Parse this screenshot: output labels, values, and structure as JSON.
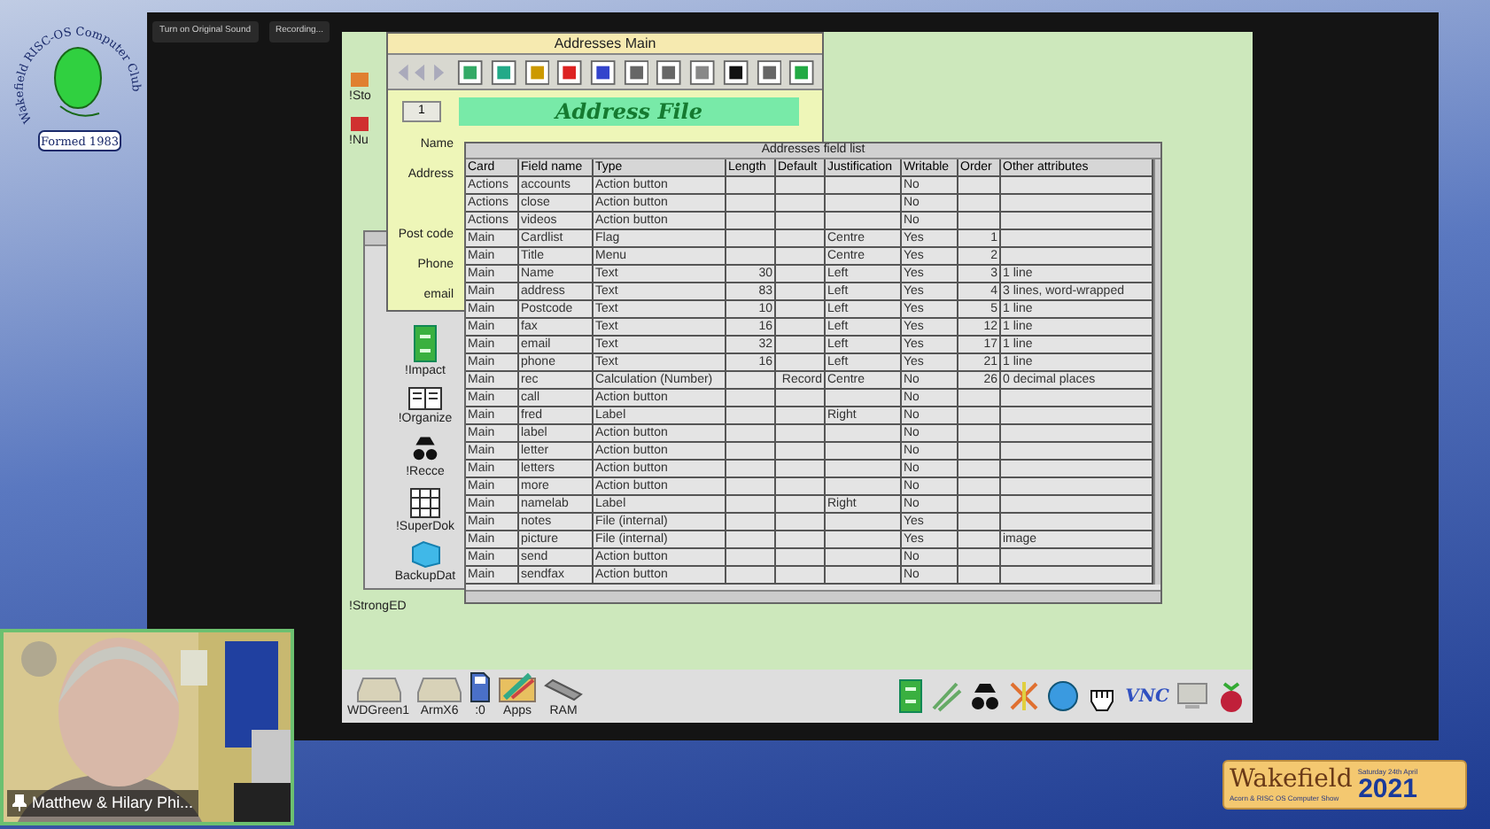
{
  "stream_bar": {
    "tabs": [
      "Turn on Original Sound",
      "Recording..."
    ]
  },
  "logo": {
    "name": "Wakefield RISC-OS Computer Club",
    "formed": "Formed 1983"
  },
  "desktop_icons": [
    "!Sto",
    "!Nu"
  ],
  "main_window": {
    "title": "Addresses Main",
    "record": "1",
    "banner": "Address File",
    "labels": [
      "Name",
      "Address",
      "Post code",
      "Phone",
      "email"
    ]
  },
  "filer": {
    "items": [
      "!Impact",
      "!Organize",
      "!Recce",
      "!SuperDok",
      "BackupDat"
    ]
  },
  "strong_ed": "!StrongED",
  "field_list": {
    "title": "Addresses field list",
    "columns": [
      "Card",
      "Field name",
      "Type",
      "Length",
      "Default",
      "Justification",
      "Writable",
      "Order",
      "Other attributes"
    ],
    "rows": [
      [
        "Actions",
        "accounts",
        "Action button",
        "",
        "",
        "",
        "No",
        "",
        ""
      ],
      [
        "Actions",
        "close",
        "Action button",
        "",
        "",
        "",
        "No",
        "",
        ""
      ],
      [
        "Actions",
        "videos",
        "Action button",
        "",
        "",
        "",
        "No",
        "",
        ""
      ],
      [
        "Main",
        "Cardlist",
        "Flag",
        "",
        "",
        "Centre",
        "Yes",
        "1",
        ""
      ],
      [
        "Main",
        "Title",
        "Menu",
        "",
        "",
        "Centre",
        "Yes",
        "2",
        ""
      ],
      [
        "Main",
        "Name",
        "Text",
        "30",
        "",
        "Left",
        "Yes",
        "3",
        "1 line"
      ],
      [
        "Main",
        "address",
        "Text",
        "83",
        "",
        "Left",
        "Yes",
        "4",
        "3 lines, word-wrapped"
      ],
      [
        "Main",
        "Postcode",
        "Text",
        "10",
        "",
        "Left",
        "Yes",
        "5",
        "1 line"
      ],
      [
        "Main",
        "fax",
        "Text",
        "16",
        "",
        "Left",
        "Yes",
        "12",
        "1 line"
      ],
      [
        "Main",
        "email",
        "Text",
        "32",
        "",
        "Left",
        "Yes",
        "17",
        "1 line"
      ],
      [
        "Main",
        "phone",
        "Text",
        "16",
        "",
        "Left",
        "Yes",
        "21",
        "1 line"
      ],
      [
        "Main",
        "rec",
        "Calculation (Number)",
        "",
        "Record",
        "Centre",
        "No",
        "26",
        "0 decimal places"
      ],
      [
        "Main",
        "call",
        "Action button",
        "",
        "",
        "",
        "No",
        "",
        ""
      ],
      [
        "Main",
        "fred",
        "Label",
        "",
        "",
        "Right",
        "No",
        "",
        ""
      ],
      [
        "Main",
        "label",
        "Action button",
        "",
        "",
        "",
        "No",
        "",
        ""
      ],
      [
        "Main",
        "letter",
        "Action button",
        "",
        "",
        "",
        "No",
        "",
        ""
      ],
      [
        "Main",
        "letters",
        "Action button",
        "",
        "",
        "",
        "No",
        "",
        ""
      ],
      [
        "Main",
        "more",
        "Action button",
        "",
        "",
        "",
        "No",
        "",
        ""
      ],
      [
        "Main",
        "namelab",
        "Label",
        "",
        "",
        "Right",
        "No",
        "",
        ""
      ],
      [
        "Main",
        "notes",
        "File (internal)",
        "",
        "",
        "",
        "Yes",
        "",
        ""
      ],
      [
        "Main",
        "picture",
        "File (internal)",
        "",
        "",
        "",
        "Yes",
        "",
        "image"
      ],
      [
        "Main",
        "send",
        "Action button",
        "",
        "",
        "",
        "No",
        "",
        ""
      ],
      [
        "Main",
        "sendfax",
        "Action button",
        "",
        "",
        "",
        "No",
        "",
        ""
      ]
    ]
  },
  "icon_bar": {
    "devices": [
      "WDGreen1",
      "ArmX6",
      ":0",
      "Apps",
      "RAM"
    ],
    "vnc": "VNC"
  },
  "webcam": {
    "name": "Matthew & Hilary Phi..."
  },
  "show_badge": {
    "name": "Wakefield",
    "date": "Saturday 24th April",
    "year": "2021",
    "subtitle": "Acorn & RISC OS Computer Show"
  }
}
